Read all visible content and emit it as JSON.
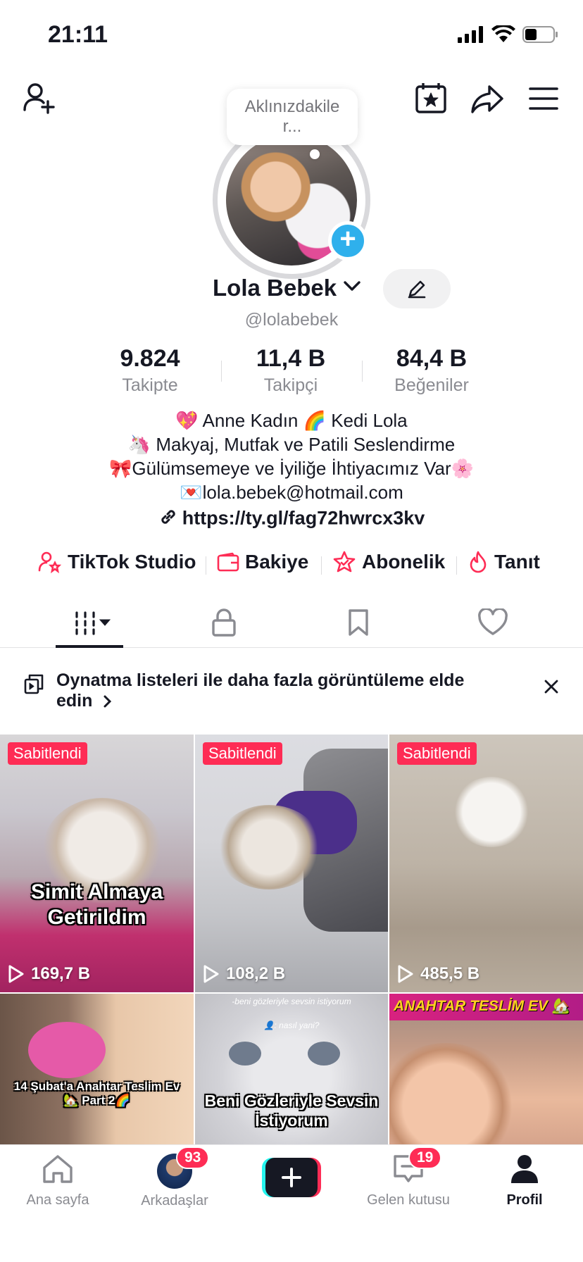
{
  "status_bar": {
    "time": "21:11"
  },
  "thought_bubble": {
    "text": "Aklınızdakile r..."
  },
  "profile": {
    "name": "Lola Bebek",
    "handle": "@lolabebek",
    "stats": [
      {
        "value": "9.824",
        "label": "Takipte"
      },
      {
        "value": "11,4 B",
        "label": "Takipçi"
      },
      {
        "value": "84,4 B",
        "label": "Beğeniler"
      }
    ],
    "bio_lines": [
      "💖 Anne Kadın 🌈 Kedi Lola",
      "🦄 Makyaj, Mutfak ve Patili  Seslendirme",
      "🎀Gülümsemeye ve İyiliğe İhtiyacımız Var🌸",
      "💌lola.bebek@hotmail.com"
    ],
    "link": "https://ty.gl/fag72hwrcx3kv"
  },
  "quick_links": [
    {
      "label": "TikTok Studio",
      "icon": "person-star-icon"
    },
    {
      "label": "Bakiye",
      "icon": "wallet-icon"
    },
    {
      "label": "Abonelik",
      "icon": "star-badge-icon"
    },
    {
      "label": "Tanıt",
      "icon": "flame-icon"
    }
  ],
  "tabs": [
    {
      "name": "videos",
      "icon": "grid-bars-icon",
      "active": true
    },
    {
      "name": "private",
      "icon": "lock-icon"
    },
    {
      "name": "saved",
      "icon": "bookmark-icon"
    },
    {
      "name": "liked",
      "icon": "heart-icon"
    }
  ],
  "promo": {
    "text": "Oynatma listeleri ile daha fazla görüntüleme elde edin"
  },
  "videos": [
    {
      "pinned_label": "Sabitlendi",
      "views": "169,7 B",
      "caption": "Simit Almaya Getirildim"
    },
    {
      "pinned_label": "Sabitlendi",
      "views": "108,2 B",
      "caption": ""
    },
    {
      "pinned_label": "Sabitlendi",
      "views": "485,5 B",
      "caption": ""
    },
    {
      "pinned_label": "",
      "views": "",
      "caption": "14 Şubat'a Anahtar Teslim Ev 🏡 Part 2🌈"
    },
    {
      "pinned_label": "",
      "views": "",
      "caption": "Beni Gözleriyle Sevsin İstiyorum",
      "small_text_1": "-beni gözleriyle sevsin istiyorum",
      "small_text_2": "👤: nasıl yani?"
    },
    {
      "pinned_label": "",
      "views": "",
      "caption": "ANAHTAR TESLİM EV 🏡"
    }
  ],
  "bottom_nav": [
    {
      "label": "Ana sayfa",
      "icon": "home-icon"
    },
    {
      "label": "Arkadaşlar",
      "icon": "friends-avatar",
      "badge": "93"
    },
    {
      "label": "",
      "icon": "create-plus-icon"
    },
    {
      "label": "Gelen kutusu",
      "icon": "inbox-icon",
      "badge": "19"
    },
    {
      "label": "Profil",
      "icon": "profile-icon",
      "active": true
    }
  ],
  "colors": {
    "accent": "#fe2c55",
    "blue": "#2fb0ec",
    "text": "#161823",
    "muted": "#8a8b91"
  }
}
